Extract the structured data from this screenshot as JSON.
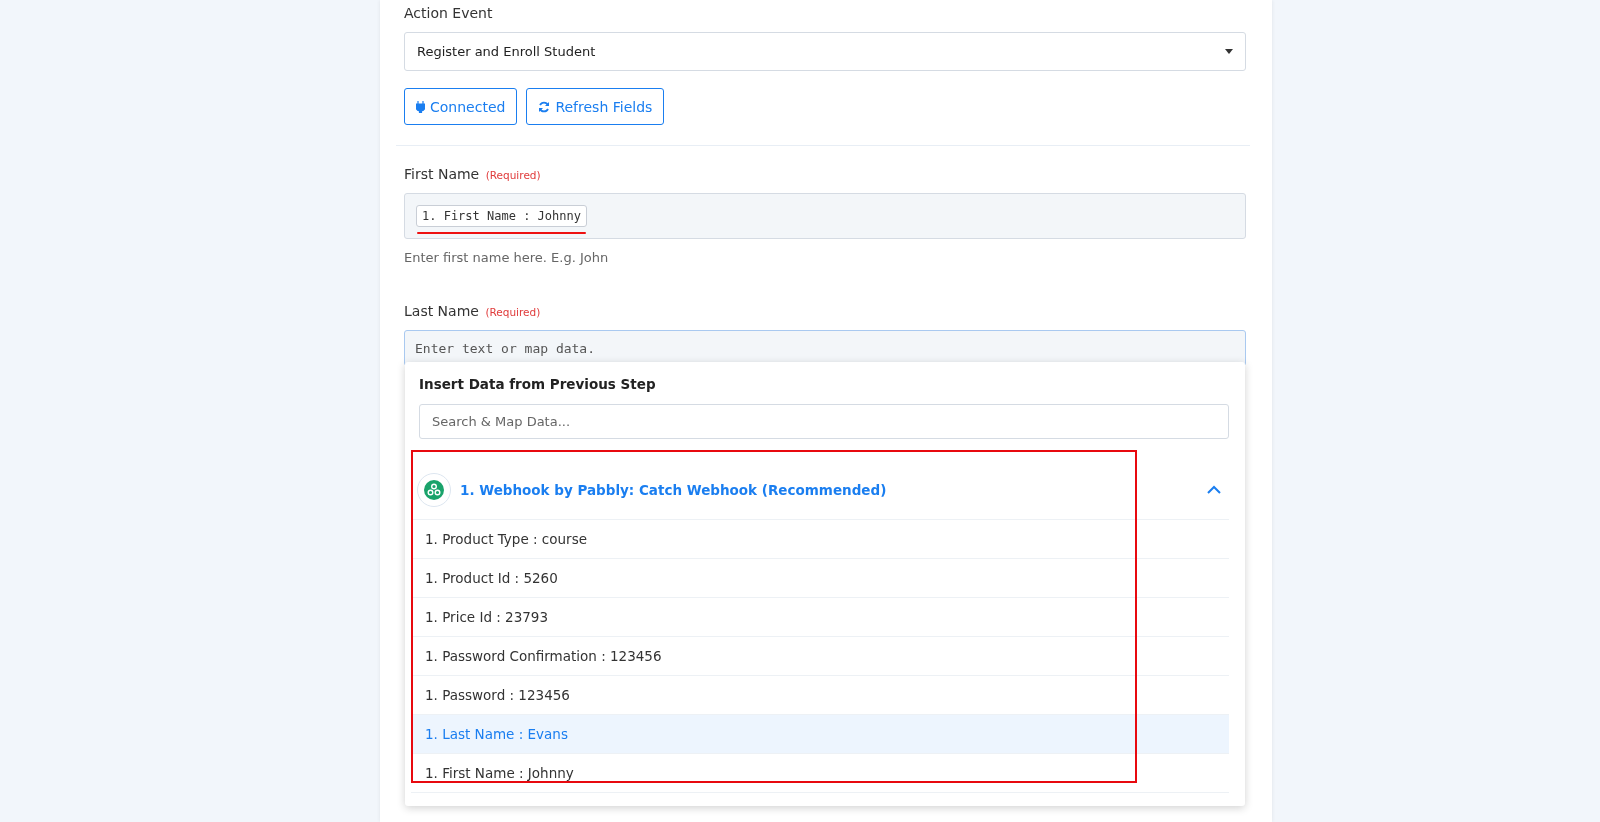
{
  "action_event": {
    "label": "Action Event",
    "value": "Register and Enroll Student"
  },
  "buttons": [
    {
      "kind": "plug",
      "label": "Connected"
    },
    {
      "kind": "refresh",
      "label": "Refresh Fields"
    }
  ],
  "first_name": {
    "label": "First Name",
    "required": "(Required)",
    "token": "1. First Name : Johnny",
    "hint": "Enter first name here. E.g. John"
  },
  "last_name": {
    "label": "Last Name",
    "required": "(Required)",
    "placeholder": "Enter text or map data.",
    "focused": true
  },
  "dropdown": {
    "title": "Insert Data from Previous Step",
    "search_placeholder": "Search & Map Data...",
    "step": {
      "title": "1. Webhook by Pabbly: Catch Webhook (Recommended)",
      "expanded": true
    },
    "items": [
      {
        "label": "1. Product Type : course",
        "selected": false
      },
      {
        "label": "1. Product Id : 5260",
        "selected": false
      },
      {
        "label": "1. Price Id : 23793",
        "selected": false
      },
      {
        "label": "1. Password Confirmation : 123456",
        "selected": false
      },
      {
        "label": "1. Password : 123456",
        "selected": false
      },
      {
        "label": "1. Last Name : Evans",
        "selected": true
      },
      {
        "label": "1. First Name : Johnny",
        "selected": false
      }
    ]
  }
}
